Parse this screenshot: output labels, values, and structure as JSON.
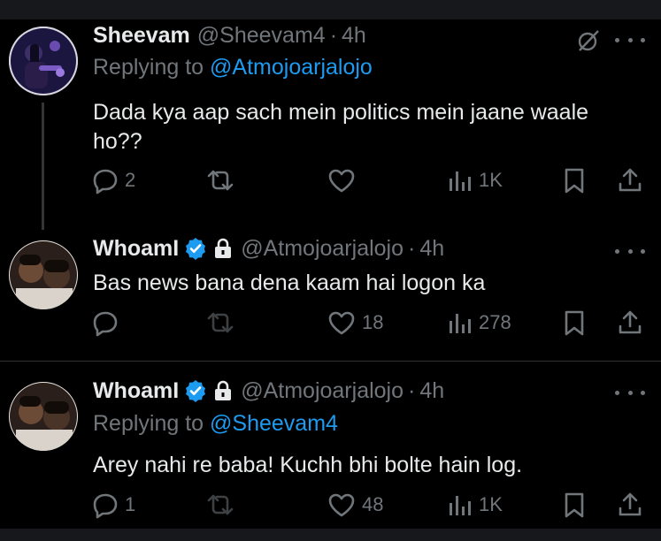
{
  "tweets": [
    {
      "name": "Sheevam",
      "handle": "@Sheevam4",
      "separator": "·",
      "time": "4h",
      "replying_prefix": "Replying to",
      "replying_handle": "@Atmojoarjalojo",
      "text_line1": "Dada kya aap sach mein politics mein jaane waale",
      "text_line2": "ho??",
      "replies": "2",
      "retweets": "",
      "likes": "",
      "views": "1K"
    },
    {
      "name": "WhoamI",
      "handle": "@Atmojoarjalojo",
      "separator": "·",
      "time": "4h",
      "text": "Bas news bana dena kaam hai logon ka",
      "replies": "",
      "retweets": "",
      "likes": "18",
      "views": "278"
    },
    {
      "name": "WhoamI",
      "handle": "@Atmojoarjalojo",
      "separator": "·",
      "time": "4h",
      "replying_prefix": "Replying to",
      "replying_handle": "@Sheevam4",
      "text": "Arey nahi re baba! Kuchh bhi bolte hain log.",
      "replies": "1",
      "retweets": "",
      "likes": "48",
      "views": "1K"
    }
  ],
  "colors": {
    "background": "#000000",
    "text": "#e7e9ea",
    "muted": "#71767b",
    "link": "#1d9bf0",
    "verified": "#1d9bf0",
    "divider": "#2f3336"
  },
  "icons": [
    "reply-icon",
    "retweet-icon",
    "like-icon",
    "views-icon",
    "bookmark-icon",
    "share-icon",
    "more-icon",
    "grok-icon",
    "verified-icon",
    "lock-icon"
  ]
}
